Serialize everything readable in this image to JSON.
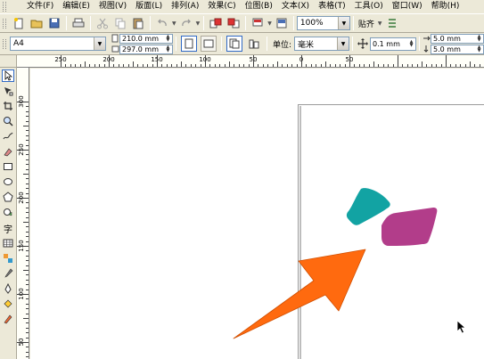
{
  "menubar": {
    "items": [
      "文件(F)",
      "编辑(E)",
      "视图(V)",
      "版面(L)",
      "排列(A)",
      "效果(C)",
      "位图(B)",
      "文本(X)",
      "表格(T)",
      "工具(O)",
      "窗口(W)",
      "帮助(H)"
    ]
  },
  "toolbar": {
    "zoom_value": "100%",
    "snap_label": "贴齐"
  },
  "property_bar": {
    "paper_size": "A4",
    "width": "210.0 mm",
    "height": "297.0 mm",
    "units_label": "单位:",
    "units_value": "毫米",
    "nudge": "0.1 mm",
    "dup_x": "5.0 mm",
    "dup_y": "5.0 mm"
  },
  "rulers": {
    "h_labels": [
      "250",
      "200",
      "150",
      "100",
      "50",
      "0",
      "50"
    ],
    "v_labels": [
      "300",
      "250",
      "200",
      "150",
      "100",
      "50"
    ]
  },
  "canvas": {
    "shape_colors": {
      "teal": "#12a3a3",
      "magenta": "#b23d8a",
      "arrow": "#ff6a0f"
    }
  }
}
